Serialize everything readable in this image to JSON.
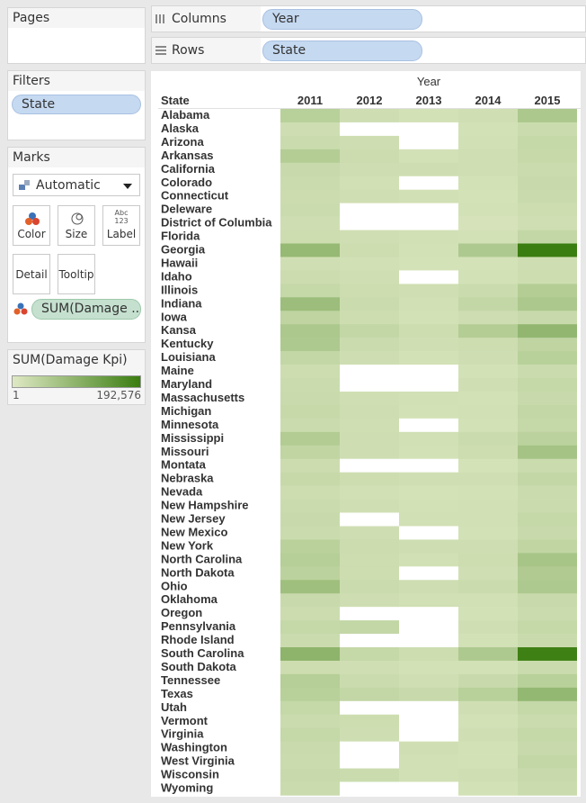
{
  "pages_card": {
    "title": "Pages"
  },
  "filters_card": {
    "title": "Filters",
    "pill": "State"
  },
  "marks_card": {
    "title": "Marks",
    "mark_type": "Automatic",
    "buttons": {
      "color": "Color",
      "size": "Size",
      "label": "Label",
      "detail": "Detail",
      "tooltip": "Tooltip"
    },
    "label_glyph_top": "Abc",
    "label_glyph_bottom": "123",
    "color_pill": "SUM(Damage .."
  },
  "legend": {
    "title": "SUM(Damage Kpi)",
    "min_label": "1",
    "max_label": "192,576",
    "color_low": "#dfe9c4",
    "color_high": "#3a7d10"
  },
  "columns_shelf": {
    "label": "Columns",
    "pill": "Year"
  },
  "rows_shelf": {
    "label": "Rows",
    "pill": "State"
  },
  "chart_data": {
    "type": "heatmap",
    "column_header": "Year",
    "row_header": "State",
    "x": [
      "2011",
      "2012",
      "2013",
      "2014",
      "2015"
    ],
    "y": [
      "Alabama",
      "Alaska",
      "Arizona",
      "Arkansas",
      "California",
      "Colorado",
      "Connecticut",
      "Deleware",
      "District of Columbia",
      "Florida",
      "Georgia",
      "Hawaii",
      "Idaho",
      "Illinois",
      "Indiana",
      "Iowa",
      "Kansa",
      "Kentucky",
      "Louisiana",
      "Maine",
      "Maryland",
      "Massachusetts",
      "Michigan",
      "Minnesota",
      "Mississippi",
      "Missouri",
      "Montata",
      "Nebraska",
      "Nevada",
      "New Hampshire",
      "New Jersey",
      "New Mexico",
      "New York",
      "North Carolina",
      "North Dakota",
      "Ohio",
      "Oklahoma",
      "Oregon",
      "Pennsylvania",
      "Rhode Island",
      "South Carolina",
      "South Dakota",
      "Tennessee",
      "Texas",
      "Utah",
      "Vermont",
      "Virginia",
      "Washington",
      "West Virginia",
      "Wisconsin",
      "Wyoming"
    ],
    "z": [
      [
        28000,
        9000,
        6000,
        8000,
        40000
      ],
      [
        9000,
        null,
        null,
        6000,
        12000
      ],
      [
        12000,
        9000,
        null,
        7000,
        16000
      ],
      [
        32000,
        11000,
        6000,
        8000,
        15000
      ],
      [
        14000,
        9000,
        9000,
        8000,
        12000
      ],
      [
        12000,
        7000,
        null,
        6000,
        14000
      ],
      [
        11000,
        8000,
        7000,
        5000,
        13000
      ],
      [
        12000,
        null,
        null,
        6000,
        10000
      ],
      [
        9000,
        null,
        null,
        4000,
        8000
      ],
      [
        10000,
        8000,
        7000,
        6000,
        18000
      ],
      [
        65000,
        10000,
        6000,
        38000,
        192576
      ],
      [
        8000,
        7000,
        5000,
        5000,
        9000
      ],
      [
        11000,
        8000,
        null,
        6000,
        10000
      ],
      [
        16000,
        10000,
        8000,
        12000,
        32000
      ],
      [
        58000,
        12000,
        7000,
        18000,
        40000
      ],
      [
        22000,
        10000,
        6000,
        9000,
        14000
      ],
      [
        40000,
        18000,
        10000,
        32000,
        70000
      ],
      [
        38000,
        12000,
        8000,
        10000,
        22000
      ],
      [
        18000,
        9000,
        6000,
        9000,
        28000
      ],
      [
        10000,
        null,
        null,
        6000,
        12000
      ],
      [
        12000,
        null,
        null,
        8000,
        16000
      ],
      [
        13000,
        8000,
        7000,
        6000,
        14000
      ],
      [
        15000,
        9000,
        6000,
        7000,
        18000
      ],
      [
        12000,
        8000,
        null,
        6000,
        16000
      ],
      [
        34000,
        9000,
        7000,
        12000,
        24000
      ],
      [
        20000,
        9000,
        6000,
        10000,
        48000
      ],
      [
        11000,
        null,
        null,
        5000,
        12000
      ],
      [
        15000,
        10000,
        8000,
        8000,
        18000
      ],
      [
        10000,
        7000,
        5000,
        6000,
        12000
      ],
      [
        12000,
        8000,
        6000,
        7000,
        12000
      ],
      [
        14000,
        null,
        7000,
        7000,
        16000
      ],
      [
        12000,
        9000,
        null,
        6000,
        14000
      ],
      [
        26000,
        11000,
        9000,
        9000,
        20000
      ],
      [
        30000,
        10000,
        7000,
        10000,
        45000
      ],
      [
        24000,
        10000,
        null,
        8000,
        36000
      ],
      [
        55000,
        12000,
        9000,
        12000,
        38000
      ],
      [
        14000,
        9000,
        7000,
        7000,
        14000
      ],
      [
        11000,
        null,
        null,
        6000,
        12000
      ],
      [
        16000,
        18000,
        null,
        8000,
        16000
      ],
      [
        12000,
        null,
        null,
        6000,
        13000
      ],
      [
        75000,
        16000,
        10000,
        38000,
        185000
      ],
      [
        10000,
        8000,
        6000,
        6000,
        12000
      ],
      [
        30000,
        12000,
        8000,
        14000,
        28000
      ],
      [
        28000,
        18000,
        14000,
        28000,
        68000
      ],
      [
        16000,
        null,
        null,
        8000,
        16000
      ],
      [
        12000,
        10000,
        null,
        6000,
        12000
      ],
      [
        16000,
        9000,
        null,
        8000,
        16000
      ],
      [
        13000,
        null,
        8000,
        6000,
        14000
      ],
      [
        12000,
        null,
        7000,
        6000,
        18000
      ],
      [
        14000,
        12000,
        7000,
        8000,
        14000
      ],
      [
        12000,
        null,
        null,
        6000,
        12000
      ]
    ],
    "zlim": [
      1,
      192576
    ]
  }
}
